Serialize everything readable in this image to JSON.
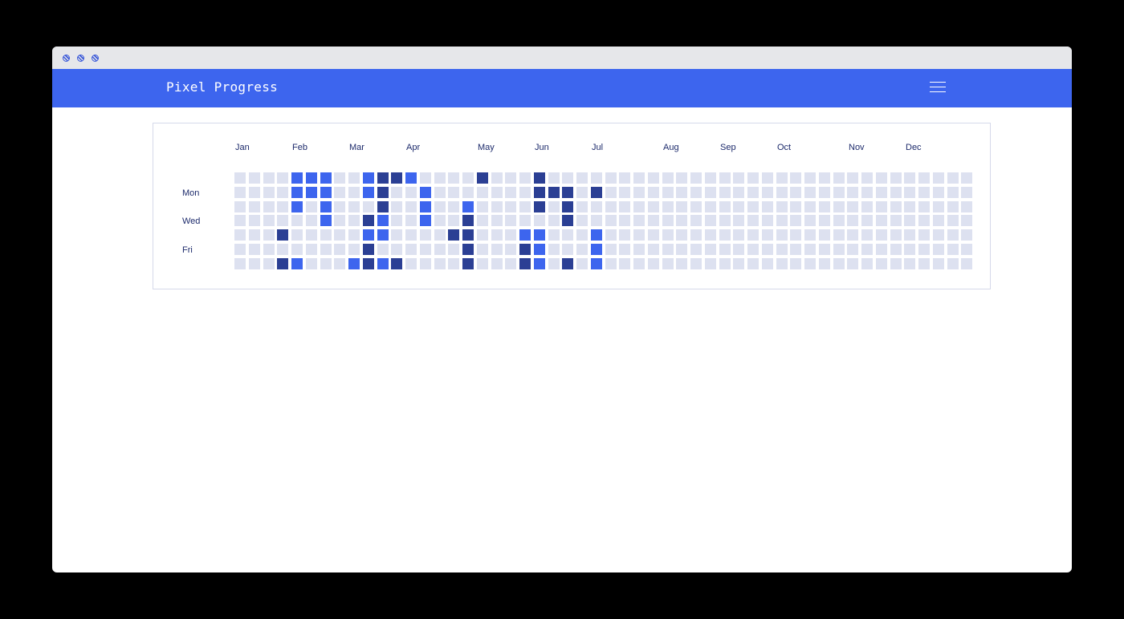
{
  "app": {
    "title": "Pixel Progress",
    "accent_color": "#3d65ee",
    "menu_icon": "hamburger-menu-icon"
  },
  "window": {
    "controls": [
      "window-dot-icon",
      "window-dot-icon",
      "window-dot-icon"
    ]
  },
  "heatmap": {
    "months": [
      "Jan",
      "Feb",
      "Mar",
      "Apr",
      "May",
      "Jun",
      "Jul",
      "Aug",
      "Sep",
      "Oct",
      "Nov",
      "Dec"
    ],
    "day_labels": [
      "Mon",
      "Wed",
      "Fri"
    ],
    "weeks": 52,
    "days_per_week": 7,
    "colors": {
      "empty": "#dde1f0",
      "level_1": "#3d65ee",
      "level_2": "#2b3f94"
    },
    "active_cells": [
      {
        "week": 4,
        "day": 0,
        "level": 1
      },
      {
        "week": 4,
        "day": 1,
        "level": 1
      },
      {
        "week": 4,
        "day": 2,
        "level": 1
      },
      {
        "week": 4,
        "day": 6,
        "level": 1
      },
      {
        "week": 3,
        "day": 4,
        "level": 2
      },
      {
        "week": 3,
        "day": 6,
        "level": 2
      },
      {
        "week": 5,
        "day": 0,
        "level": 1
      },
      {
        "week": 5,
        "day": 1,
        "level": 1
      },
      {
        "week": 6,
        "day": 0,
        "level": 1
      },
      {
        "week": 6,
        "day": 1,
        "level": 1
      },
      {
        "week": 6,
        "day": 2,
        "level": 1
      },
      {
        "week": 6,
        "day": 3,
        "level": 1
      },
      {
        "week": 8,
        "day": 6,
        "level": 1
      },
      {
        "week": 9,
        "day": 0,
        "level": 1
      },
      {
        "week": 9,
        "day": 1,
        "level": 1
      },
      {
        "week": 9,
        "day": 3,
        "level": 2
      },
      {
        "week": 9,
        "day": 4,
        "level": 1
      },
      {
        "week": 9,
        "day": 5,
        "level": 2
      },
      {
        "week": 9,
        "day": 6,
        "level": 2
      },
      {
        "week": 10,
        "day": 0,
        "level": 2
      },
      {
        "week": 10,
        "day": 1,
        "level": 2
      },
      {
        "week": 10,
        "day": 2,
        "level": 2
      },
      {
        "week": 10,
        "day": 3,
        "level": 1
      },
      {
        "week": 10,
        "day": 4,
        "level": 1
      },
      {
        "week": 10,
        "day": 6,
        "level": 1
      },
      {
        "week": 11,
        "day": 0,
        "level": 2
      },
      {
        "week": 11,
        "day": 6,
        "level": 2
      },
      {
        "week": 12,
        "day": 0,
        "level": 1
      },
      {
        "week": 13,
        "day": 1,
        "level": 1
      },
      {
        "week": 13,
        "day": 2,
        "level": 1
      },
      {
        "week": 13,
        "day": 3,
        "level": 1
      },
      {
        "week": 15,
        "day": 4,
        "level": 2
      },
      {
        "week": 16,
        "day": 2,
        "level": 1
      },
      {
        "week": 16,
        "day": 3,
        "level": 2
      },
      {
        "week": 16,
        "day": 4,
        "level": 2
      },
      {
        "week": 16,
        "day": 5,
        "level": 2
      },
      {
        "week": 16,
        "day": 6,
        "level": 2
      },
      {
        "week": 17,
        "day": 0,
        "level": 2
      },
      {
        "week": 20,
        "day": 4,
        "level": 1
      },
      {
        "week": 20,
        "day": 5,
        "level": 2
      },
      {
        "week": 20,
        "day": 6,
        "level": 2
      },
      {
        "week": 21,
        "day": 0,
        "level": 2
      },
      {
        "week": 21,
        "day": 1,
        "level": 2
      },
      {
        "week": 21,
        "day": 2,
        "level": 2
      },
      {
        "week": 21,
        "day": 4,
        "level": 1
      },
      {
        "week": 21,
        "day": 5,
        "level": 1
      },
      {
        "week": 21,
        "day": 6,
        "level": 1
      },
      {
        "week": 22,
        "day": 1,
        "level": 2
      },
      {
        "week": 23,
        "day": 1,
        "level": 2
      },
      {
        "week": 23,
        "day": 2,
        "level": 2
      },
      {
        "week": 23,
        "day": 3,
        "level": 2
      },
      {
        "week": 23,
        "day": 6,
        "level": 2
      },
      {
        "week": 25,
        "day": 1,
        "level": 2
      },
      {
        "week": 25,
        "day": 4,
        "level": 1
      },
      {
        "week": 25,
        "day": 5,
        "level": 1
      },
      {
        "week": 25,
        "day": 6,
        "level": 1
      }
    ]
  }
}
